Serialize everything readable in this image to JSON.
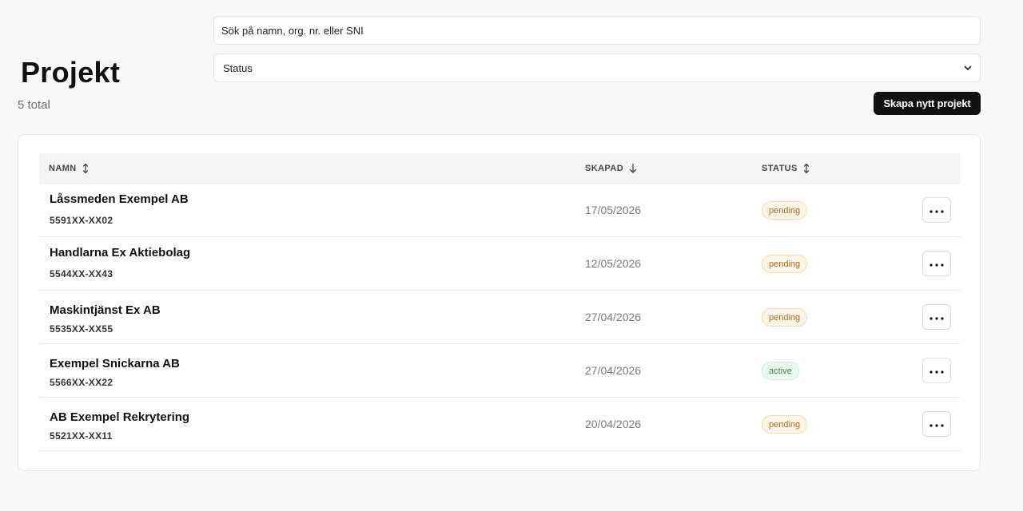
{
  "header": {
    "title": "Projekt",
    "count_label": "5 total"
  },
  "search": {
    "placeholder": "Sök på namn, org. nr. eller SNI"
  },
  "status_filter": {
    "selected": "Status",
    "icon": "chevron-down-icon"
  },
  "create_button": {
    "label": "Skapa nytt projekt"
  },
  "table": {
    "columns": {
      "name": "NAMN",
      "created": "SKAPAD",
      "status": "STATUS"
    },
    "sort_icons": {
      "name": "sort-both-icon",
      "created": "sort-descending-icon",
      "status": "sort-both-icon"
    },
    "rows": [
      {
        "name": "Låssmeden Exempel AB",
        "org_nr": "5591XX-XX02",
        "created": "17/05/2026",
        "status": "pending"
      },
      {
        "name": "Handlarna Ex Aktiebolag",
        "org_nr": "5544XX-XX43",
        "created": "12/05/2026",
        "status": "pending"
      },
      {
        "name": "Maskintjänst Ex AB",
        "org_nr": "5535XX-XX55",
        "created": "27/04/2026",
        "status": "pending"
      },
      {
        "name": "Exempel Snickarna AB",
        "org_nr": "5566XX-XX22",
        "created": "27/04/2026",
        "status": "active"
      },
      {
        "name": "AB Exempel Rekrytering",
        "org_nr": "5521XX-XX11",
        "created": "20/04/2026",
        "status": "pending"
      }
    ]
  },
  "colors": {
    "pending_text": "#b4681a",
    "pending_bg": "#fdf6e8",
    "active_text": "#2f8a46",
    "active_bg": "#eefaf0",
    "primary_button": "#111111"
  }
}
